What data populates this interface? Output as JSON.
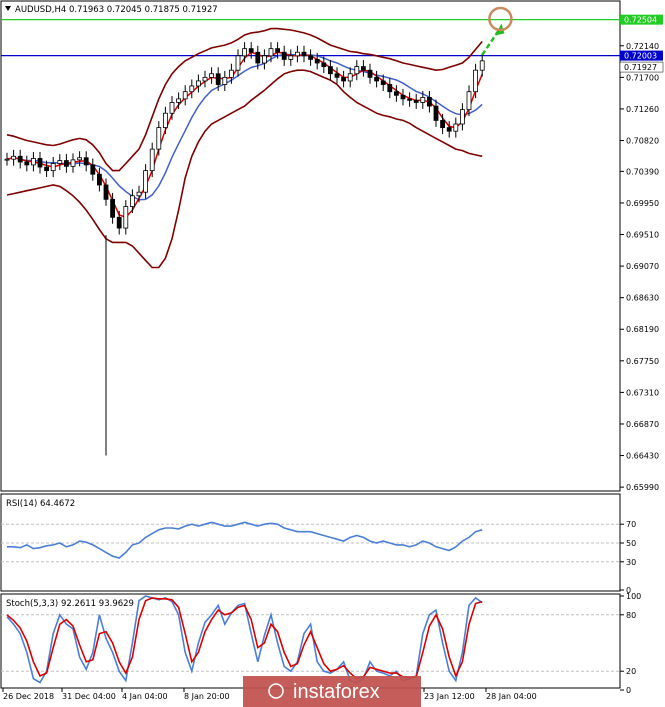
{
  "chart_data": [
    {
      "type": "candlestick",
      "symbol": "AUDUSD,H4",
      "header": "AUDUSD,H4  0.71963 0.72045 0.71875 0.71927",
      "ohlc": {
        "open": 0.71963,
        "high": 0.72045,
        "low": 0.71875,
        "close": 0.71927
      },
      "ylim": [
        0.6595,
        0.7275
      ],
      "y_ticks": [
        "0.72500",
        "0.72140",
        "0.71700",
        "0.71260",
        "0.70820",
        "0.70390",
        "0.69950",
        "0.69510",
        "0.69070",
        "0.68630",
        "0.68190",
        "0.67750",
        "0.67310",
        "0.66870",
        "0.66430",
        "0.65990"
      ],
      "y_tick_values": [
        0.725,
        0.7214,
        0.717,
        0.7126,
        0.7082,
        0.7039,
        0.6995,
        0.6951,
        0.6907,
        0.6863,
        0.6819,
        0.6775,
        0.6731,
        0.6687,
        0.6643,
        0.6599
      ],
      "x_ticks": [
        "26 Dec 2018",
        "31 Dec 04:00",
        "4 Jan 04:00",
        "8 Jan 20:00",
        "23 Jan 12:00",
        "28 Jan 04:00"
      ],
      "horizontal_lines": [
        {
          "label": "0.72504",
          "value": 0.72504,
          "color": "#22cc22"
        },
        {
          "label": "0.72003",
          "value": 0.72003,
          "color": "#0000cc"
        }
      ],
      "current_price_label": "0.71927",
      "current_price": 0.71927,
      "closes": [
        0.7056,
        0.706,
        0.7052,
        0.7048,
        0.7057,
        0.7045,
        0.704,
        0.705,
        0.7054,
        0.7046,
        0.7055,
        0.7058,
        0.7048,
        0.7035,
        0.702,
        0.7,
        0.6975,
        0.696,
        0.699,
        0.7005,
        0.701,
        0.704,
        0.707,
        0.71,
        0.712,
        0.7135,
        0.714,
        0.715,
        0.7158,
        0.7165,
        0.717,
        0.7175,
        0.716,
        0.717,
        0.718,
        0.72,
        0.721,
        0.7205,
        0.719,
        0.72,
        0.721,
        0.7205,
        0.7195,
        0.72,
        0.7205,
        0.72,
        0.7195,
        0.719,
        0.7185,
        0.7175,
        0.717,
        0.7165,
        0.7175,
        0.7185,
        0.718,
        0.717,
        0.7165,
        0.716,
        0.715,
        0.7145,
        0.714,
        0.7138,
        0.7135,
        0.7142,
        0.713,
        0.711,
        0.71,
        0.7095,
        0.7105,
        0.7125,
        0.715,
        0.718,
        0.7193
      ],
      "bollinger": {
        "upper": [
          0.709,
          0.7088,
          0.7085,
          0.7082,
          0.708,
          0.7078,
          0.7076,
          0.7075,
          0.7077,
          0.708,
          0.7083,
          0.7085,
          0.7083,
          0.7076,
          0.7065,
          0.705,
          0.704,
          0.704,
          0.705,
          0.706,
          0.707,
          0.709,
          0.7115,
          0.714,
          0.716,
          0.7175,
          0.7185,
          0.7193,
          0.7198,
          0.7203,
          0.7207,
          0.7211,
          0.7213,
          0.7215,
          0.7218,
          0.7223,
          0.7229,
          0.7232,
          0.7233,
          0.7235,
          0.7238,
          0.7238,
          0.7237,
          0.7236,
          0.7234,
          0.7232,
          0.7229,
          0.7225,
          0.722,
          0.7215,
          0.7212,
          0.7209,
          0.7206,
          0.7205,
          0.7203,
          0.7202,
          0.72,
          0.7198,
          0.7196,
          0.7193,
          0.719,
          0.7188,
          0.7186,
          0.7184,
          0.7182,
          0.718,
          0.7181,
          0.7184,
          0.7187,
          0.719,
          0.7198,
          0.7209,
          0.722
        ],
        "lower": [
          0.7006,
          0.7008,
          0.701,
          0.7012,
          0.7014,
          0.7016,
          0.7018,
          0.702,
          0.7018,
          0.7012,
          0.7005,
          0.6996,
          0.6985,
          0.6972,
          0.6958,
          0.6945,
          0.694,
          0.694,
          0.694,
          0.6935,
          0.6925,
          0.6915,
          0.6905,
          0.6905,
          0.6918,
          0.6945,
          0.6985,
          0.703,
          0.706,
          0.708,
          0.7095,
          0.7105,
          0.711,
          0.7115,
          0.712,
          0.7125,
          0.713,
          0.7138,
          0.7145,
          0.7152,
          0.716,
          0.7168,
          0.7175,
          0.7178,
          0.718,
          0.718,
          0.7178,
          0.7174,
          0.717,
          0.7166,
          0.716,
          0.715,
          0.7142,
          0.7135,
          0.713,
          0.7125,
          0.712,
          0.7117,
          0.7115,
          0.7112,
          0.711,
          0.7106,
          0.71,
          0.7095,
          0.709,
          0.7085,
          0.708,
          0.7075,
          0.707,
          0.7068,
          0.7064,
          0.7062,
          0.706
        ]
      },
      "rendering": {
        "x_start": 3,
        "x_step": 6.6,
        "plot_right": 620,
        "plot_top": 2,
        "plot_bottom": 490,
        "bar_colors": {
          "up": "#000000",
          "down": "#000000"
        },
        "fast_ma_color": "#dd0000",
        "slow_ma_color": "#4060cc",
        "bollinger_color": "#800000",
        "spike_low": 0.6643,
        "spike_index": 15
      },
      "annotations": [
        {
          "kind": "arrow",
          "color": "#22bb22",
          "from_index": 72,
          "to_value": 0.7248
        },
        {
          "kind": "circle",
          "color": "#c88a60",
          "index": 74,
          "value": 0.725
        }
      ]
    },
    {
      "type": "line",
      "name": "RSI",
      "header": "RSI(14) 64.4672",
      "ylim": [
        0,
        100
      ],
      "y_ticks": [
        "70",
        "50",
        "30",
        "0"
      ],
      "levels": [
        70,
        50,
        30
      ],
      "values": [
        46,
        46,
        45,
        48,
        44,
        45,
        47,
        48,
        50,
        46,
        48,
        52,
        51,
        48,
        44,
        40,
        36,
        34,
        40,
        48,
        50,
        56,
        60,
        64,
        66,
        66,
        65,
        68,
        70,
        68,
        70,
        72,
        70,
        68,
        68,
        70,
        72,
        70,
        68,
        70,
        71,
        70,
        66,
        64,
        62,
        62,
        62,
        60,
        58,
        56,
        54,
        52,
        56,
        58,
        56,
        52,
        50,
        52,
        50,
        48,
        48,
        46,
        48,
        52,
        50,
        46,
        44,
        42,
        46,
        52,
        56,
        62,
        64
      ],
      "color": "#4a7fd6",
      "plot_top": 496,
      "plot_bottom": 590
    },
    {
      "type": "line",
      "name": "Stochastic",
      "header": "Stoch(5,3,3) 92.2611 93.9629",
      "ylim": [
        0,
        100
      ],
      "y_ticks": [
        "100",
        "80",
        "20",
        "0"
      ],
      "levels": [
        80,
        20
      ],
      "main": [
        78,
        70,
        60,
        40,
        12,
        8,
        20,
        60,
        80,
        70,
        65,
        35,
        22,
        40,
        80,
        55,
        40,
        20,
        10,
        50,
        95,
        100,
        98,
        96,
        98,
        94,
        80,
        40,
        20,
        50,
        72,
        80,
        90,
        70,
        82,
        90,
        92,
        60,
        30,
        58,
        80,
        50,
        25,
        20,
        30,
        60,
        70,
        30,
        20,
        18,
        22,
        30,
        10,
        8,
        12,
        30,
        20,
        18,
        15,
        20,
        10,
        12,
        15,
        60,
        80,
        85,
        50,
        20,
        10,
        40,
        90,
        98,
        93
      ],
      "signal": [
        80,
        74,
        66,
        52,
        30,
        15,
        18,
        45,
        70,
        75,
        68,
        48,
        30,
        32,
        60,
        62,
        50,
        30,
        18,
        35,
        75,
        95,
        98,
        97,
        97,
        96,
        88,
        60,
        30,
        40,
        62,
        75,
        85,
        80,
        82,
        88,
        90,
        75,
        45,
        50,
        70,
        62,
        40,
        25,
        28,
        48,
        62,
        45,
        28,
        20,
        22,
        26,
        18,
        12,
        14,
        24,
        22,
        20,
        18,
        18,
        14,
        13,
        14,
        40,
        68,
        80,
        65,
        35,
        15,
        30,
        70,
        92,
        94
      ],
      "main_color": "#4a7fd6",
      "signal_color": "#dd0000",
      "plot_top": 596,
      "plot_bottom": 690
    }
  ],
  "watermark": "instaforex",
  "colors": {
    "background": "#ffffff",
    "grid": "#c0c0c0",
    "border": "#000000",
    "watermark_bg": "#c0504d"
  }
}
